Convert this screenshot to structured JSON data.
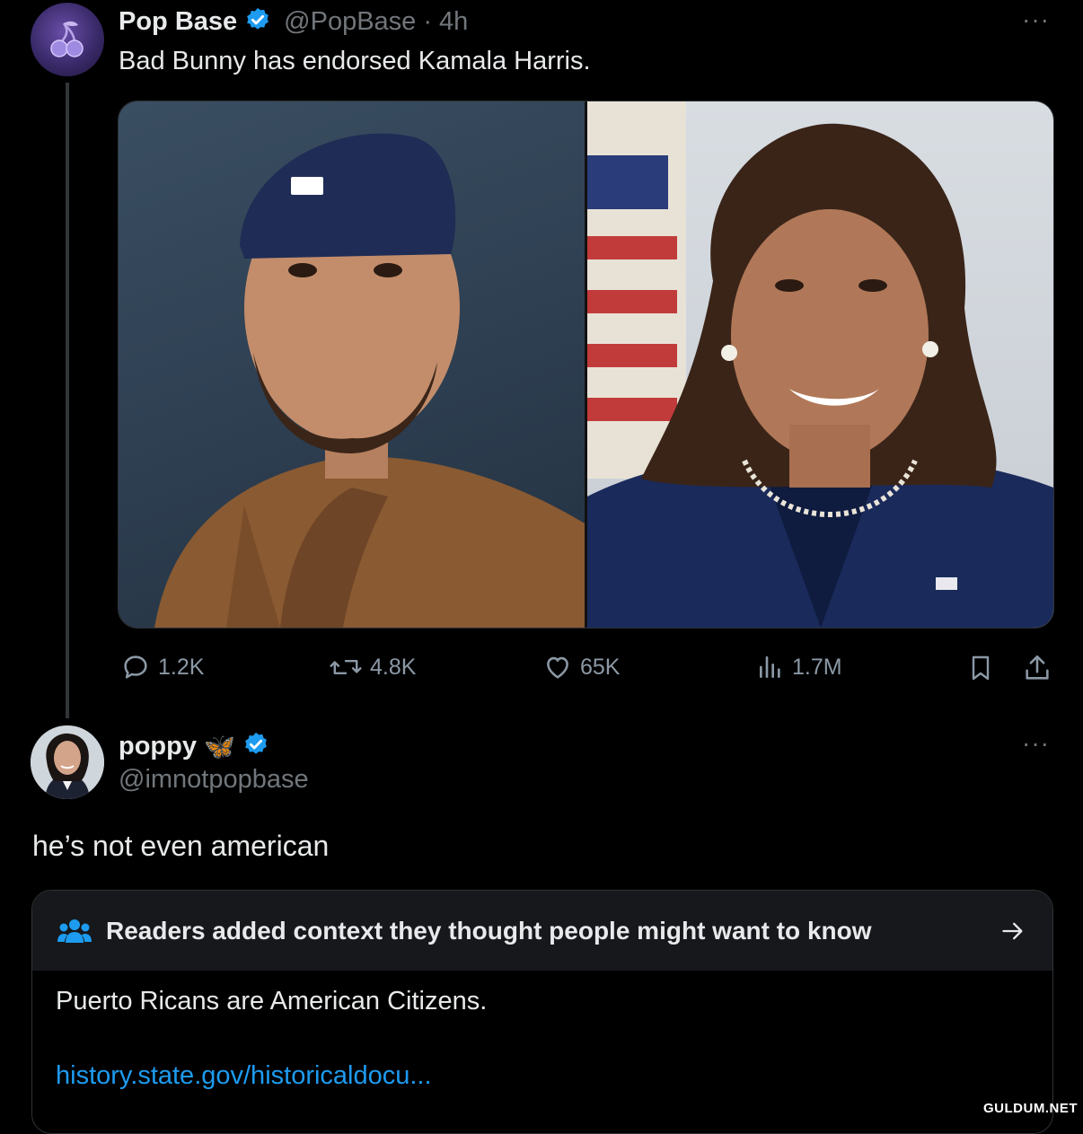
{
  "tweet": {
    "author_name": "Pop Base",
    "handle": "@PopBase",
    "separator": "·",
    "time": "4h",
    "text": "Bad Bunny has endorsed Kamala Harris.",
    "more": "···",
    "actions": {
      "replies": "1.2K",
      "reposts": "4.8K",
      "likes": "65K",
      "views": "1.7M"
    }
  },
  "reply": {
    "author_name": "poppy",
    "emoji": "🦋",
    "handle": "@imnotpopbase",
    "more": "···",
    "text": "he’s not even american"
  },
  "community_note": {
    "title": "Readers added context they thought people might want to know",
    "text": "Puerto Ricans are American Citizens.",
    "link": "history.state.gov/historicaldocu..."
  },
  "watermark": "GULDUM.NET",
  "colors": {
    "background": "#000000",
    "text": "#e7e9ea",
    "muted": "#71767b",
    "link": "#1d9bf0",
    "verified": "#1d9bf0",
    "note_header_bg": "#16181c"
  }
}
